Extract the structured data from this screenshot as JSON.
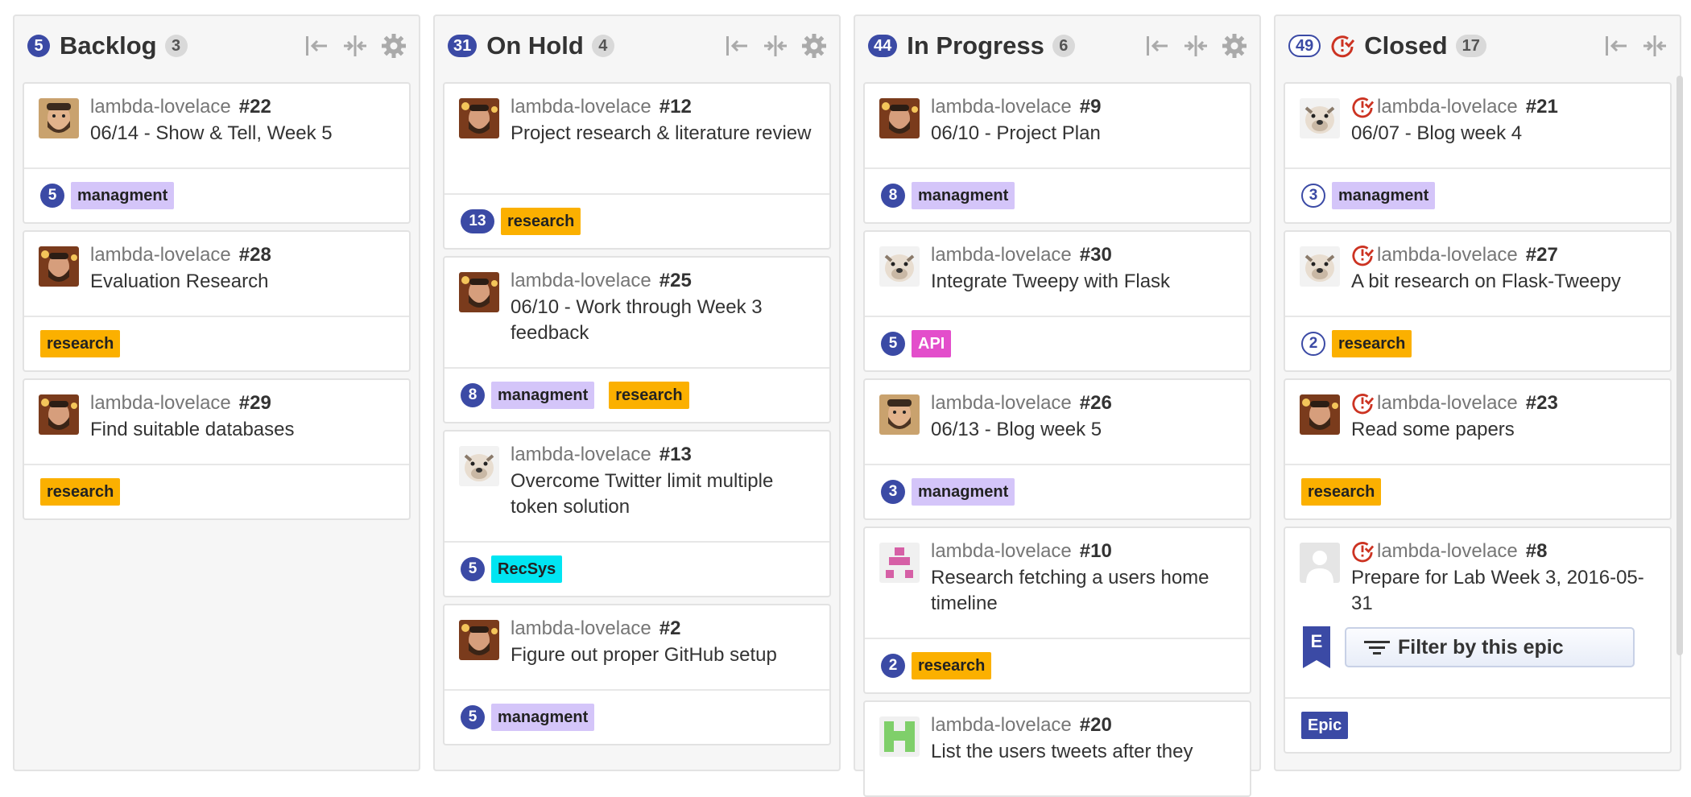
{
  "colors": {
    "estimate": "#3b4aa5",
    "closed_icon": "#cc3322",
    "label_managment": "#d4c5f9",
    "label_research": "#fbb000",
    "label_api": "#e34ecb",
    "label_recsys": "#00e5f2",
    "label_epic": "#3b4aa5"
  },
  "columns": [
    {
      "name": "Backlog",
      "points": "5",
      "count": "3",
      "cards": [
        {
          "user": "lambda-lovelace",
          "number": "#22",
          "title": "06/14 - Show & Tell, Week 5",
          "avatar": "avatar-bearded-man-icon",
          "estimate": "5",
          "labels": [
            "managment"
          ]
        },
        {
          "user": "lambda-lovelace",
          "number": "#28",
          "title": "Evaluation Research",
          "avatar": "avatar-bearded-man-icon",
          "estimate": "",
          "labels": [
            "research"
          ]
        },
        {
          "user": "lambda-lovelace",
          "number": "#29",
          "title": "Find suitable databases",
          "avatar": "avatar-bearded-man-icon",
          "estimate": "",
          "labels": [
            "research"
          ]
        }
      ]
    },
    {
      "name": "On Hold",
      "points": "31",
      "count": "4",
      "cards": [
        {
          "user": "lambda-lovelace",
          "number": "#12",
          "title": "Project research & literature review",
          "avatar": "avatar-bearded-man-icon",
          "estimate": "13",
          "labels": [
            "research"
          ]
        },
        {
          "user": "lambda-lovelace",
          "number": "#25",
          "title": "06/10 - Work through Week 3 feedback",
          "avatar": "avatar-bearded-man-icon",
          "estimate": "8",
          "labels": [
            "managment",
            "research"
          ]
        },
        {
          "user": "lambda-lovelace",
          "number": "#13",
          "title": "Overcome Twitter limit multiple token solution",
          "avatar": "avatar-bulldog-icon",
          "estimate": "5",
          "labels": [
            "RecSys"
          ]
        },
        {
          "user": "lambda-lovelace",
          "number": "#2",
          "title": "Figure out proper GitHub setup",
          "avatar": "avatar-bearded-man-icon",
          "estimate": "5",
          "labels": [
            "managment"
          ]
        }
      ]
    },
    {
      "name": "In Progress",
      "points": "44",
      "count": "6",
      "cards": [
        {
          "user": "lambda-lovelace",
          "number": "#9",
          "title": "06/10 - Project Plan",
          "avatar": "avatar-bearded-man-icon",
          "estimate": "8",
          "labels": [
            "managment"
          ]
        },
        {
          "user": "lambda-lovelace",
          "number": "#30",
          "title": "Integrate Tweepy with Flask",
          "avatar": "avatar-bulldog-icon",
          "estimate": "5",
          "labels": [
            "API"
          ]
        },
        {
          "user": "lambda-lovelace",
          "number": "#26",
          "title": "06/13 - Blog week 5",
          "avatar": "avatar-bearded-man-icon",
          "estimate": "3",
          "labels": [
            "managment"
          ]
        },
        {
          "user": "lambda-lovelace",
          "number": "#10",
          "title": "Research fetching a users home timeline",
          "avatar": "avatar-pink-identicon-icon",
          "estimate": "2",
          "labels": [
            "research"
          ]
        },
        {
          "user": "lambda-lovelace",
          "number": "#20",
          "title": "List the users tweets after they",
          "avatar": "avatar-green-identicon-icon",
          "estimate": "",
          "labels": []
        }
      ]
    },
    {
      "name": "Closed",
      "points": "49",
      "count": "17",
      "cards": [
        {
          "user": "lambda-lovelace",
          "number": "#21",
          "title": "06/07 - Blog week 4",
          "avatar": "avatar-bulldog-icon",
          "estimate": "3",
          "labels": [
            "managment"
          ]
        },
        {
          "user": "lambda-lovelace",
          "number": "#27",
          "title": "A bit research on Flask-Tweepy",
          "avatar": "avatar-bulldog-icon",
          "estimate": "2",
          "labels": [
            "research"
          ]
        },
        {
          "user": "lambda-lovelace",
          "number": "#23",
          "title": "Read some papers",
          "avatar": "avatar-bearded-man-icon",
          "estimate": "",
          "labels": [
            "research"
          ]
        },
        {
          "user": "lambda-lovelace",
          "number": "#8",
          "title": "Prepare for Lab Week 3, 2016-05-31",
          "avatar": "avatar-default-icon",
          "estimate": "",
          "labels": [
            "Epic"
          ],
          "epic_letter": "E",
          "filter_label": "Filter by this epic"
        }
      ]
    }
  ]
}
